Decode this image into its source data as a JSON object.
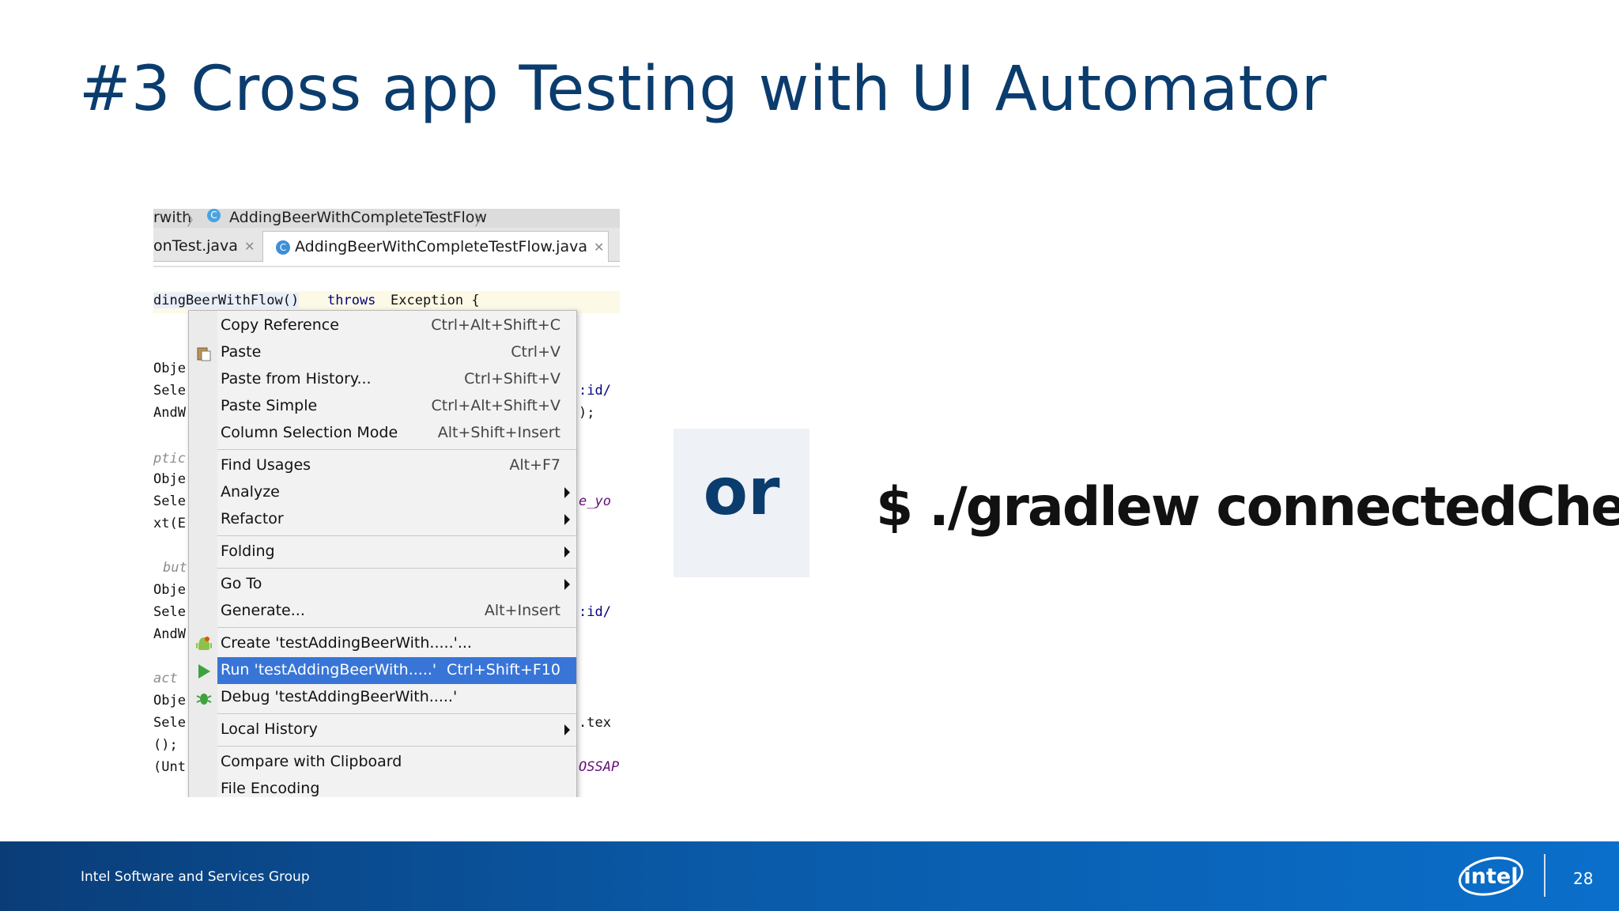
{
  "slide": {
    "title": "#3 Cross app Testing with UI Automator",
    "or_label": "or",
    "command": "$ ./gradlew connectedCheck"
  },
  "ide": {
    "breadcrumb": {
      "prefix": "rwith",
      "icon": "class-icon",
      "item": "AddingBeerWithCompleteTestFlow"
    },
    "tabs": [
      {
        "label": "onTest.java",
        "active": false
      },
      {
        "label": "AddingBeerWithCompleteTestFlow.java",
        "active": true
      }
    ],
    "code": {
      "signature_name": "dingBeerWithFlow()",
      "signature_kw": "throws",
      "signature_rest": "Exception {",
      "left_fragments": [
        "Obje",
        "Sele",
        "AndW",
        "ptic",
        "Obje",
        "Sele",
        "xt(E",
        "but",
        "Obje",
        "Sele",
        "AndW",
        "act",
        "Obje",
        "Sele",
        "();",
        "(Unt"
      ],
      "right_fragments": [
        ":id/",
        ");",
        "e_yo",
        ":id/",
        ".tex",
        "OSSAP."
      ]
    },
    "context_menu": {
      "items": [
        {
          "label": "Copy Reference",
          "shortcut": "Ctrl+Alt+Shift+C"
        },
        {
          "label": "Paste",
          "shortcut": "Ctrl+V",
          "icon": "paste-icon"
        },
        {
          "label": "Paste from History...",
          "shortcut": "Ctrl+Shift+V"
        },
        {
          "label": "Paste Simple",
          "shortcut": "Ctrl+Alt+Shift+V"
        },
        {
          "label": "Column Selection Mode",
          "shortcut": "Alt+Shift+Insert"
        },
        {
          "label": "Find Usages",
          "shortcut": "Alt+F7"
        },
        {
          "label": "Analyze",
          "submenu": true
        },
        {
          "label": "Refactor",
          "submenu": true
        },
        {
          "label": "Folding",
          "submenu": true
        },
        {
          "label": "Go To",
          "submenu": true
        },
        {
          "label": "Generate...",
          "shortcut": "Alt+Insert"
        },
        {
          "label": "Create 'testAddingBeerWith.....'...",
          "icon": "android-icon"
        },
        {
          "label": "Run 'testAddingBeerWith.....'",
          "shortcut": "Ctrl+Shift+F10",
          "icon": "run-icon",
          "highlighted": true
        },
        {
          "label": "Debug 'testAddingBeerWith.....'",
          "icon": "debug-icon"
        },
        {
          "label": "Local History",
          "submenu": true
        },
        {
          "label": "Compare with Clipboard"
        },
        {
          "label": "File Encoding"
        }
      ]
    }
  },
  "footer": {
    "group": "Intel Software and Services Group",
    "logo_text": "intel",
    "page_number": "28"
  },
  "colors": {
    "title": "#0b3c6e",
    "menu_highlight": "#3875d7",
    "footer_start": "#0a3d78",
    "footer_end": "#0a6fcb",
    "or_box": "#eef1f6"
  }
}
